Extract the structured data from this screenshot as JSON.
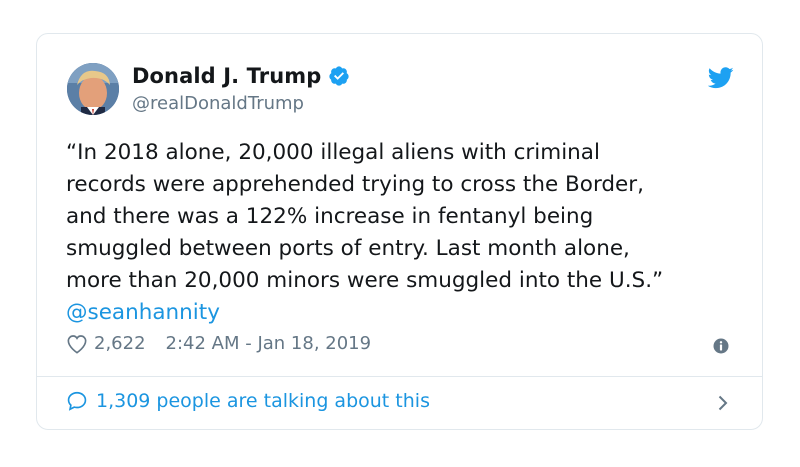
{
  "tweet": {
    "author_name": "Donald J. Trump",
    "handle": "@realDonaldTrump",
    "text": "“In 2018 alone, 20,000 illegal aliens with criminal\nrecords were apprehended trying to cross the Border,\nand there was a 122% increase in fentanyl being\nsmuggled between ports of entry. Last month alone,\nmore than 20,000 minors were smuggled into the U.S.”",
    "mention": "@seanhannity",
    "likes": "2,622",
    "timestamp": "2:42 AM - Jan 18, 2019",
    "talking_about": "1,309 people are talking about this"
  },
  "icons": {
    "verified": "verified-badge-icon",
    "brand": "twitter-bird-icon",
    "like": "heart-icon",
    "info": "info-icon",
    "reply": "speech-bubble-icon",
    "chevron": "chevron-right-icon"
  },
  "colors": {
    "accent": "#1da1f2",
    "link": "#1b95e0",
    "muted": "#657786",
    "text": "#14171a",
    "border": "#e1e8ed"
  }
}
